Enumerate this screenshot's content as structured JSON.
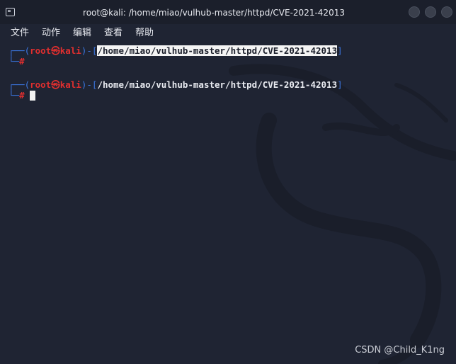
{
  "window": {
    "title": "root@kali: /home/miao/vulhub-master/httpd/CVE-2021-42013",
    "icon": "terminal-icon",
    "buttons": [
      "minimize",
      "maximize",
      "close"
    ]
  },
  "menu": {
    "file": "文件",
    "action": "动作",
    "edit": "编辑",
    "view": "查看",
    "help": "帮助"
  },
  "prompts": [
    {
      "corner_top": "┌──",
      "open_paren": "(",
      "user": "root",
      "at_symbol": "㉿",
      "host": "kali",
      "close_paren": ")",
      "dash": "-",
      "open_bracket": "[",
      "path": "/home/miao/vulhub-master/httpd/CVE-2021-42013",
      "close_bracket": "]",
      "corner_bottom": "└─",
      "hash": "#",
      "path_selected": true
    },
    {
      "corner_top": "┌──",
      "open_paren": "(",
      "user": "root",
      "at_symbol": "㉿",
      "host": "kali",
      "close_paren": ")",
      "dash": "-",
      "open_bracket": "[",
      "path": "/home/miao/vulhub-master/httpd/CVE-2021-42013",
      "close_bracket": "]",
      "corner_bottom": "└─",
      "hash": "#",
      "path_selected": false
    }
  ],
  "watermark": "CSDN @Child_K1ng",
  "colors": {
    "background": "#1f2433",
    "prompt_box": "#3b76e0",
    "user_host": "#e02f2f",
    "path": "#e8eaf0",
    "selection": "#f4f4f4"
  }
}
